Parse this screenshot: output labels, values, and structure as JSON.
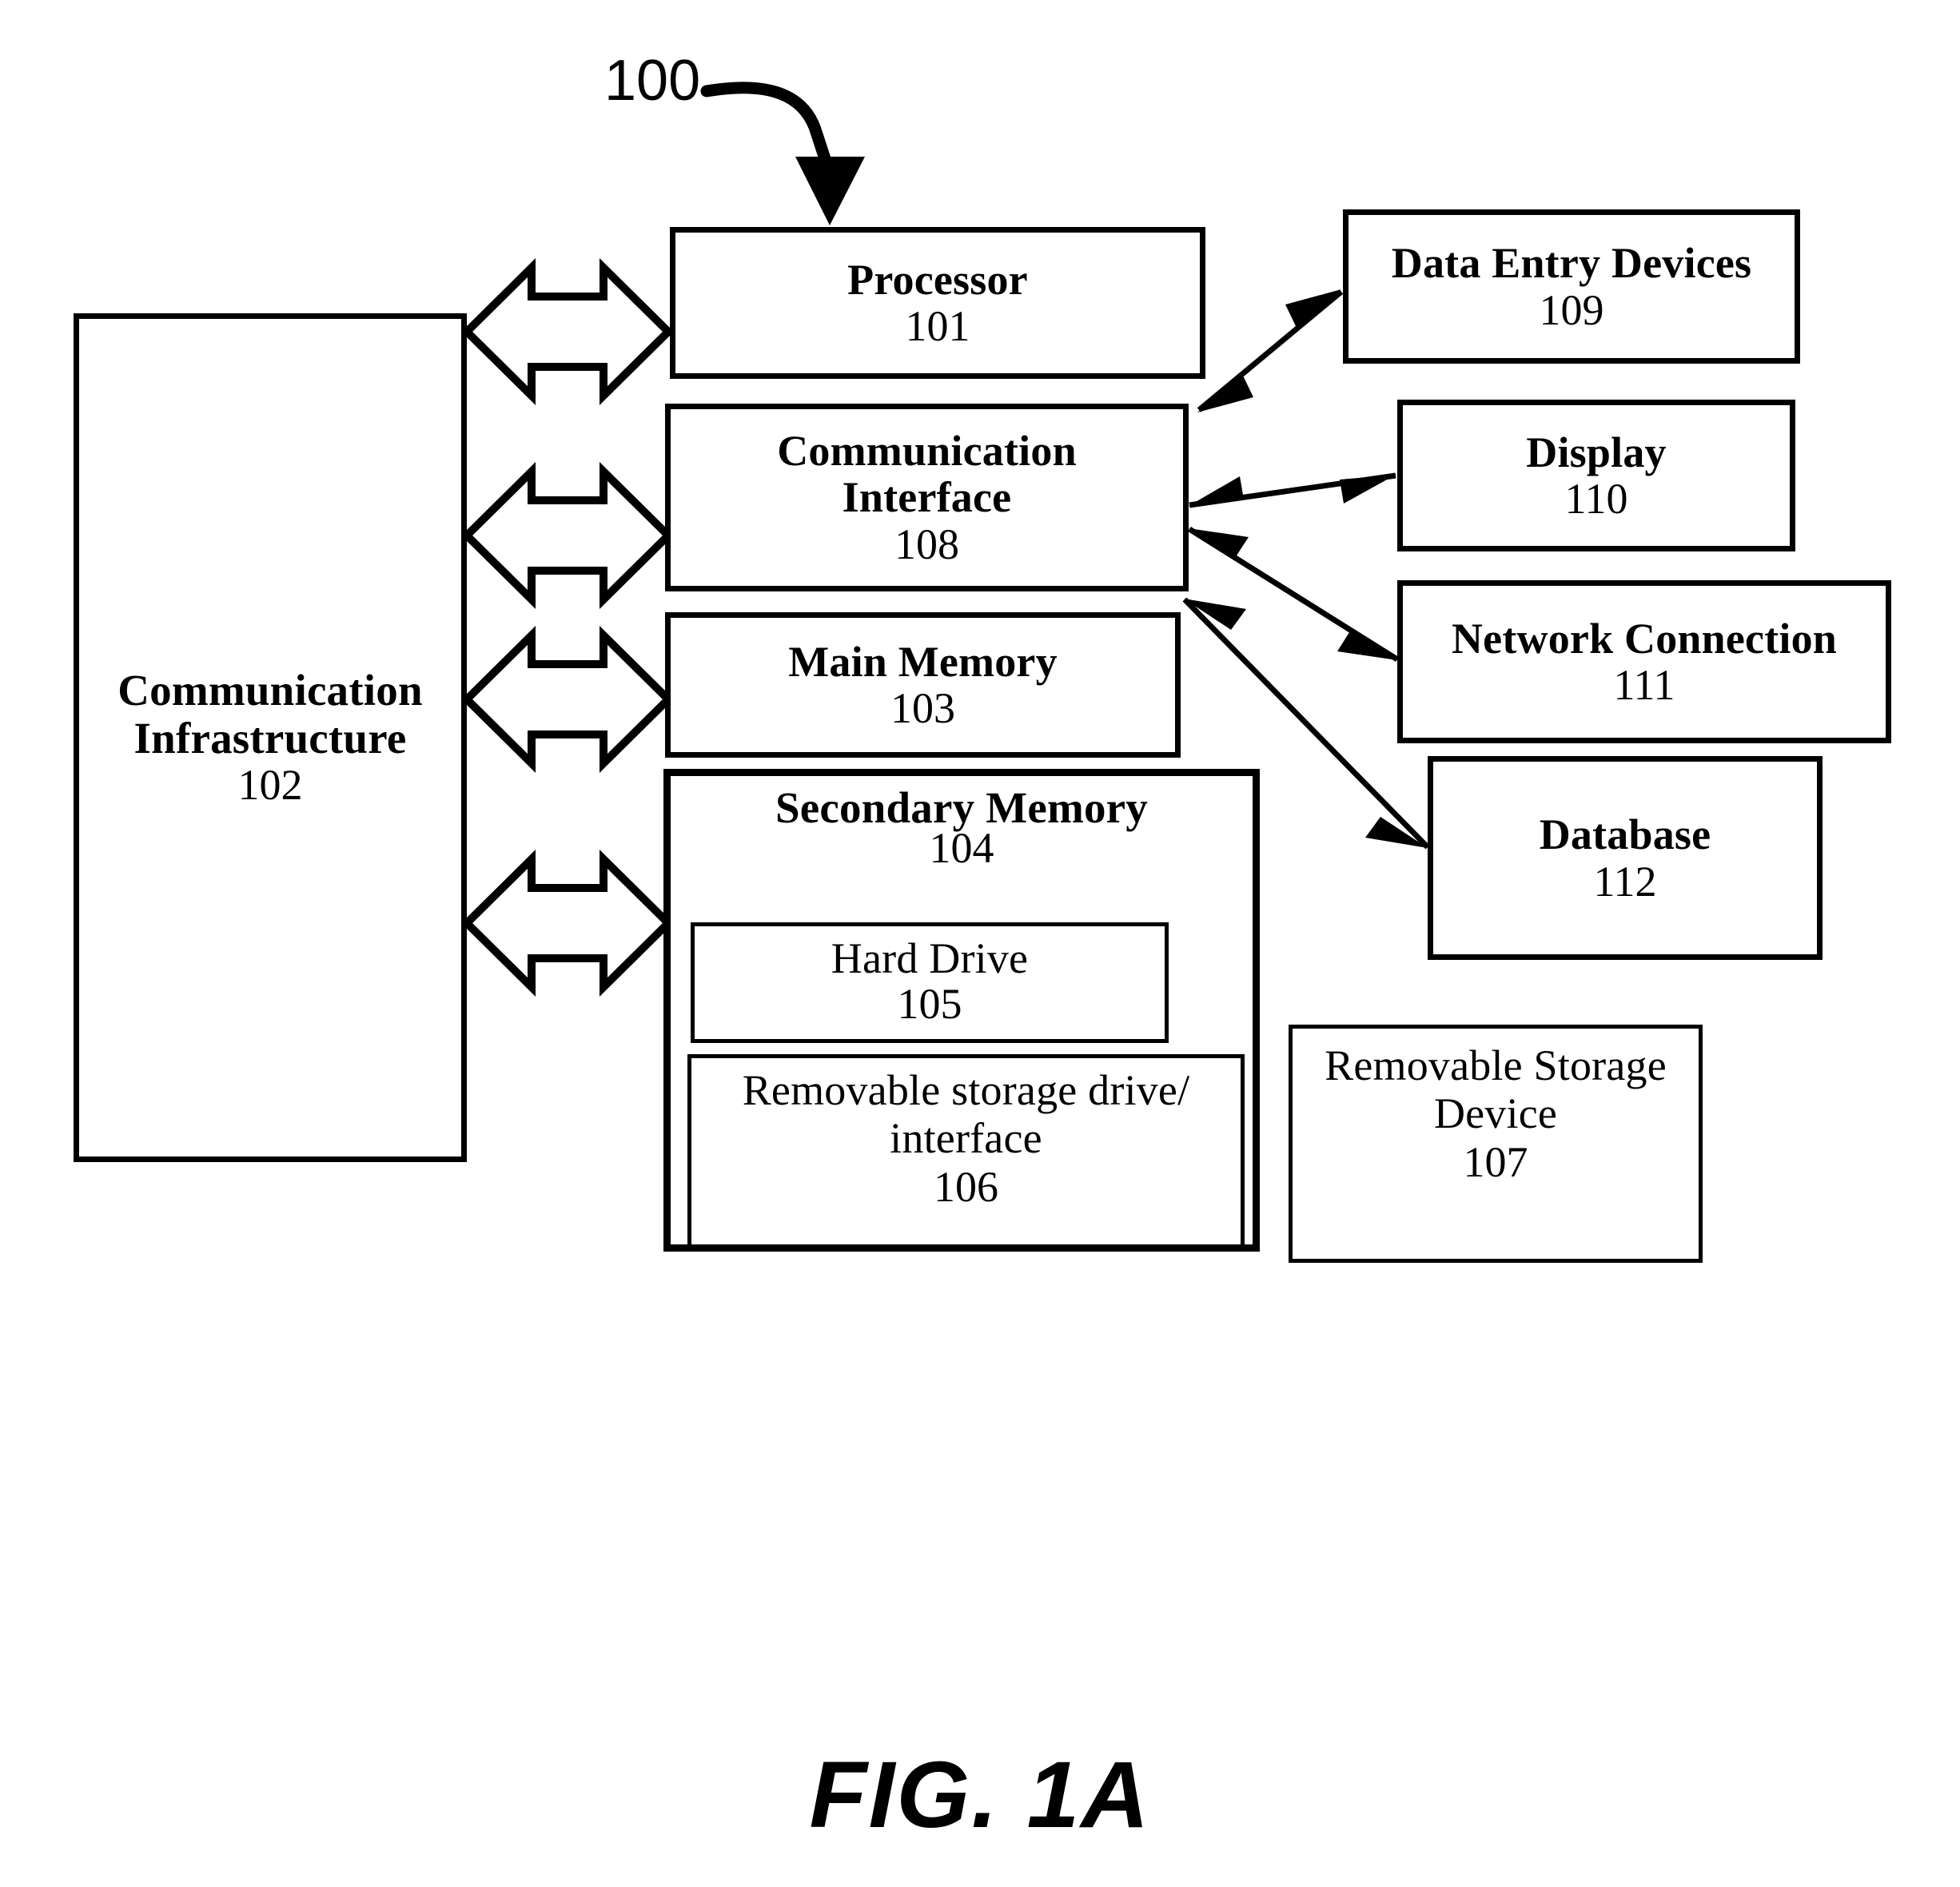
{
  "figure": {
    "reference_numeral": "100",
    "caption": "FIG. 1A",
    "stroke_color": "#000000",
    "background_color": "#ffffff"
  },
  "blocks": {
    "communication_infrastructure": {
      "label_line1": "Communication",
      "label_line2": "Infrastructure",
      "number": "102"
    },
    "processor": {
      "label": "Processor",
      "number": "101"
    },
    "communication_interface": {
      "label_line1": "Communication",
      "label_line2": "Interface",
      "number": "108"
    },
    "main_memory": {
      "label": "Main Memory",
      "number": "103"
    },
    "secondary_memory": {
      "label": "Secondary Memory",
      "number": "104",
      "children": {
        "hard_drive": {
          "label": "Hard Drive",
          "number": "105"
        },
        "removable_storage_drive": {
          "label_line1": "Removable storage drive/",
          "label_line2": "interface",
          "number": "106"
        }
      }
    },
    "data_entry_devices": {
      "label": "Data Entry Devices",
      "number": "109"
    },
    "display": {
      "label": "Display",
      "number": "110"
    },
    "network_connection": {
      "label": "Network Connection",
      "number": "111"
    },
    "database": {
      "label": "Database",
      "number": "112"
    },
    "removable_storage_device": {
      "label_line1": "Removable Storage",
      "label_line2": "Device",
      "number": "107"
    }
  },
  "connectors": {
    "bus_arrows": [
      {
        "from": "communication_infrastructure",
        "to": "processor",
        "style": "hollow-double-arrow"
      },
      {
        "from": "communication_infrastructure",
        "to": "communication_interface",
        "style": "hollow-double-arrow"
      },
      {
        "from": "communication_infrastructure",
        "to": "main_memory",
        "style": "hollow-double-arrow"
      },
      {
        "from": "communication_infrastructure",
        "to": "secondary_memory",
        "style": "hollow-double-arrow"
      }
    ],
    "interface_arrows": [
      {
        "from": "communication_interface",
        "to": "data_entry_devices",
        "style": "thin-double-arrow"
      },
      {
        "from": "communication_interface",
        "to": "display",
        "style": "thin-double-arrow"
      },
      {
        "from": "communication_interface",
        "to": "network_connection",
        "style": "thin-double-arrow"
      },
      {
        "from": "communication_interface",
        "to": "database",
        "style": "thin-double-arrow"
      }
    ],
    "callout_arrow": {
      "label": "100",
      "style": "curved-arrow",
      "points_to": "processor"
    }
  }
}
